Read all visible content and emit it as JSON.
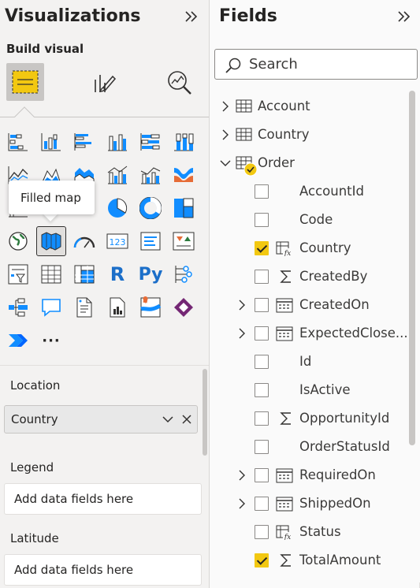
{
  "visualizations": {
    "title": "Visualizations",
    "build_visual": "Build visual",
    "tooltip": "Filled map",
    "more": "···"
  },
  "wells": {
    "location": {
      "label": "Location",
      "value": "Country"
    },
    "legend": {
      "label": "Legend",
      "placeholder": "Add data fields here"
    },
    "latitude": {
      "label": "Latitude",
      "placeholder": "Add data fields here"
    }
  },
  "fields": {
    "title": "Fields",
    "search_placeholder": "Search",
    "tables": [
      {
        "name": "Account",
        "expanded": false
      },
      {
        "name": "Country",
        "expanded": false
      },
      {
        "name": "Order",
        "expanded": true
      }
    ],
    "items": [
      {
        "name": "AccountId",
        "type": "none",
        "checked": false,
        "expandable": false
      },
      {
        "name": "Code",
        "type": "none",
        "checked": false,
        "expandable": false
      },
      {
        "name": "Country",
        "type": "measure-fx",
        "checked": true,
        "expandable": false
      },
      {
        "name": "CreatedBy",
        "type": "sum",
        "checked": false,
        "expandable": false
      },
      {
        "name": "CreatedOn",
        "type": "date",
        "checked": false,
        "expandable": true
      },
      {
        "name": "ExpectedClose...",
        "type": "date",
        "checked": false,
        "expandable": true
      },
      {
        "name": "Id",
        "type": "none",
        "checked": false,
        "expandable": false
      },
      {
        "name": "IsActive",
        "type": "none",
        "checked": false,
        "expandable": false
      },
      {
        "name": "OpportunityId",
        "type": "sum",
        "checked": false,
        "expandable": false
      },
      {
        "name": "OrderStatusId",
        "type": "none",
        "checked": false,
        "expandable": false
      },
      {
        "name": "RequiredOn",
        "type": "date",
        "checked": false,
        "expandable": true
      },
      {
        "name": "ShippedOn",
        "type": "date",
        "checked": false,
        "expandable": true
      },
      {
        "name": "Status",
        "type": "measure-fx",
        "checked": false,
        "expandable": false
      },
      {
        "name": "TotalAmount",
        "type": "sum",
        "checked": true,
        "expandable": false
      }
    ]
  },
  "colors": {
    "accent": "#f2c811",
    "blue": "#118dff",
    "panel": "#f3f2f1"
  }
}
